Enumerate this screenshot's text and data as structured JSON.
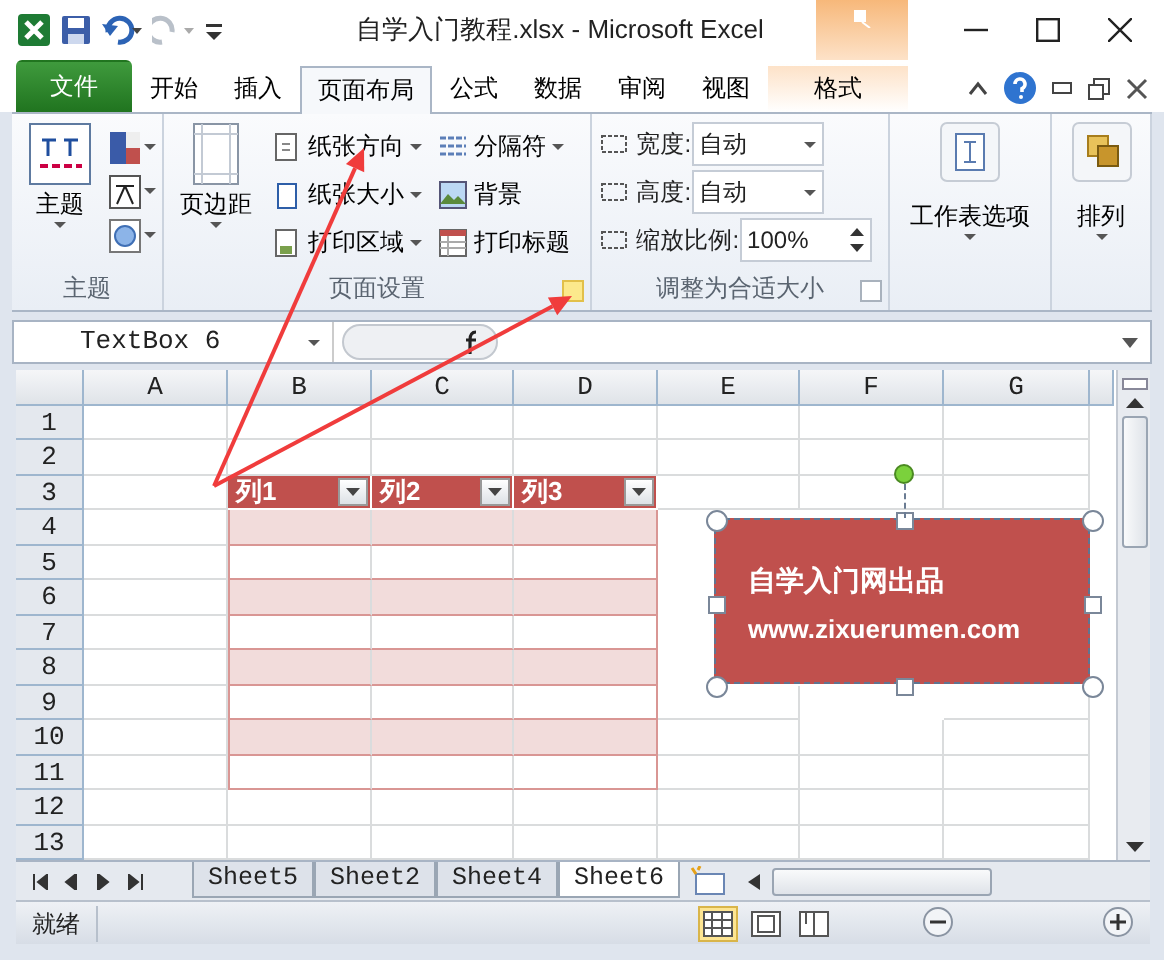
{
  "window": {
    "title": "自学入门教程.xlsx - Microsoft Excel"
  },
  "tabs": [
    {
      "label": "文件",
      "kind": "file",
      "selected": false
    },
    {
      "label": "开始",
      "kind": "normal",
      "selected": false
    },
    {
      "label": "插入",
      "kind": "normal",
      "selected": false
    },
    {
      "label": "页面布局",
      "kind": "normal",
      "selected": true
    },
    {
      "label": "公式",
      "kind": "normal",
      "selected": false
    },
    {
      "label": "数据",
      "kind": "normal",
      "selected": false
    },
    {
      "label": "审阅",
      "kind": "normal",
      "selected": false
    },
    {
      "label": "视图",
      "kind": "normal",
      "selected": false
    },
    {
      "label": "格式",
      "kind": "contextual",
      "selected": false
    }
  ],
  "ribbon": {
    "theme_group": {
      "label": "主题",
      "big_button": "主题"
    },
    "page_setup_group": {
      "label": "页面设置",
      "big_button": "页边距",
      "buttons": [
        {
          "label": "纸张方向",
          "dropdown": true
        },
        {
          "label": "分隔符",
          "dropdown": true
        },
        {
          "label": "纸张大小",
          "dropdown": true
        },
        {
          "label": "背景",
          "dropdown": false
        },
        {
          "label": "打印区域",
          "dropdown": true
        },
        {
          "label": "打印标题",
          "dropdown": false
        }
      ],
      "launcher_highlighted": true
    },
    "scale_group": {
      "label": "调整为合适大小",
      "fields": [
        {
          "label": "宽度:",
          "value": "自动",
          "kind": "dropdown"
        },
        {
          "label": "高度:",
          "value": "自动",
          "kind": "dropdown"
        },
        {
          "label": "缩放比例:",
          "value": "100%",
          "kind": "spinner"
        }
      ]
    },
    "sheet_options": {
      "label": "工作表选项"
    },
    "arrange": {
      "label": "排列"
    }
  },
  "formula_bar": {
    "name_box": "TextBox 6"
  },
  "sheet": {
    "columns": [
      "A",
      "B",
      "C",
      "D",
      "E",
      "F",
      "G"
    ],
    "rows": [
      "1",
      "2",
      "3",
      "4",
      "5",
      "6",
      "7",
      "8",
      "9",
      "10",
      "11",
      "12",
      "13"
    ],
    "table": {
      "headers": [
        "列1",
        "列2",
        "列3"
      ],
      "body_rows": [
        {
          "banded": true
        },
        {
          "banded": false
        },
        {
          "banded": true
        },
        {
          "banded": false
        },
        {
          "banded": true
        },
        {
          "banded": false
        },
        {
          "banded": true
        },
        {
          "banded": false
        }
      ]
    },
    "text_box": {
      "lines": [
        "自学入门网出品",
        "www.zixuerumen.com"
      ]
    }
  },
  "sheet_tabs": [
    {
      "label": "Sheet5",
      "selected": false
    },
    {
      "label": "Sheet2",
      "selected": false
    },
    {
      "label": "Sheet4",
      "selected": false
    },
    {
      "label": "Sheet6",
      "selected": true
    }
  ],
  "status_bar": {
    "text": "就绪",
    "views": [
      {
        "kind": "normal",
        "selected": true
      },
      {
        "kind": "page-layout",
        "selected": false
      },
      {
        "kind": "page-break",
        "selected": false
      }
    ]
  }
}
